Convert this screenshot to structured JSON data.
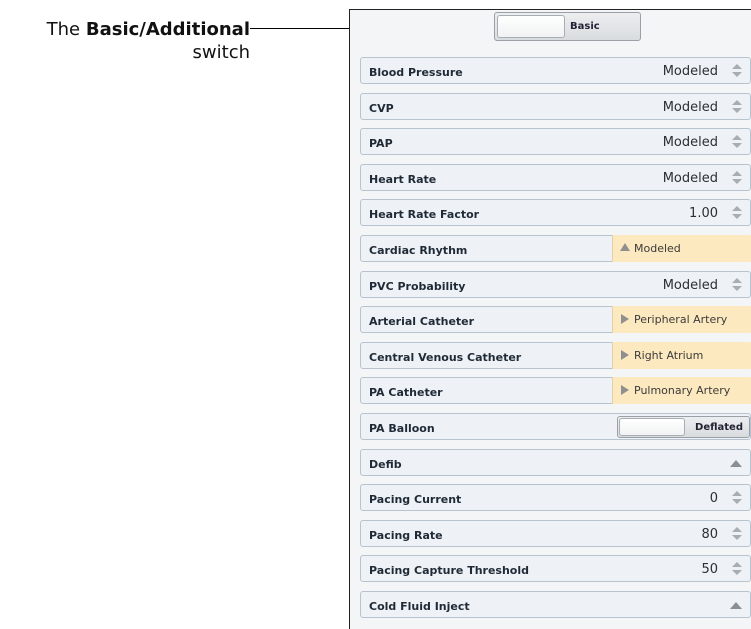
{
  "callout": {
    "prefix": "The ",
    "bold": "Basic/Additional",
    "line2": "switch"
  },
  "mode_switch": {
    "label": "Basic"
  },
  "rows": [
    {
      "name": "Blood Pressure",
      "value": "Modeled",
      "control": "stepper"
    },
    {
      "name": "CVP",
      "value": "Modeled",
      "control": "stepper"
    },
    {
      "name": "PAP",
      "value": "Modeled",
      "control": "stepper"
    },
    {
      "name": "Heart Rate",
      "value": "Modeled",
      "control": "stepper"
    },
    {
      "name": "Heart Rate Factor",
      "value": "1.00",
      "control": "stepper"
    },
    {
      "name": "Cardiac Rhythm",
      "value": "Modeled",
      "control": "disclosure-up"
    },
    {
      "name": "PVC Probability",
      "value": "Modeled",
      "control": "stepper"
    },
    {
      "name": "Arterial Catheter",
      "value": "Peripheral Artery",
      "control": "disclosure-right"
    },
    {
      "name": "Central Venous Catheter",
      "value": "Right Atrium",
      "control": "disclosure-right"
    },
    {
      "name": "PA Catheter",
      "value": "Pulmonary Artery",
      "control": "disclosure-right"
    },
    {
      "name": "PA Balloon",
      "value": "Deflated",
      "control": "toggle"
    },
    {
      "name": "Defib",
      "value": "",
      "control": "expander"
    },
    {
      "name": "Pacing Current",
      "value": "0",
      "control": "stepper"
    },
    {
      "name": "Pacing Rate",
      "value": "80",
      "control": "stepper"
    },
    {
      "name": "Pacing Capture Threshold",
      "value": "50",
      "control": "stepper"
    },
    {
      "name": "Cold Fluid Inject",
      "value": "",
      "control": "expander"
    }
  ],
  "colors": {
    "row_bg": "#eef2f6",
    "row_border": "#b7c3cf",
    "highlight_bg": "#fde9bf"
  }
}
